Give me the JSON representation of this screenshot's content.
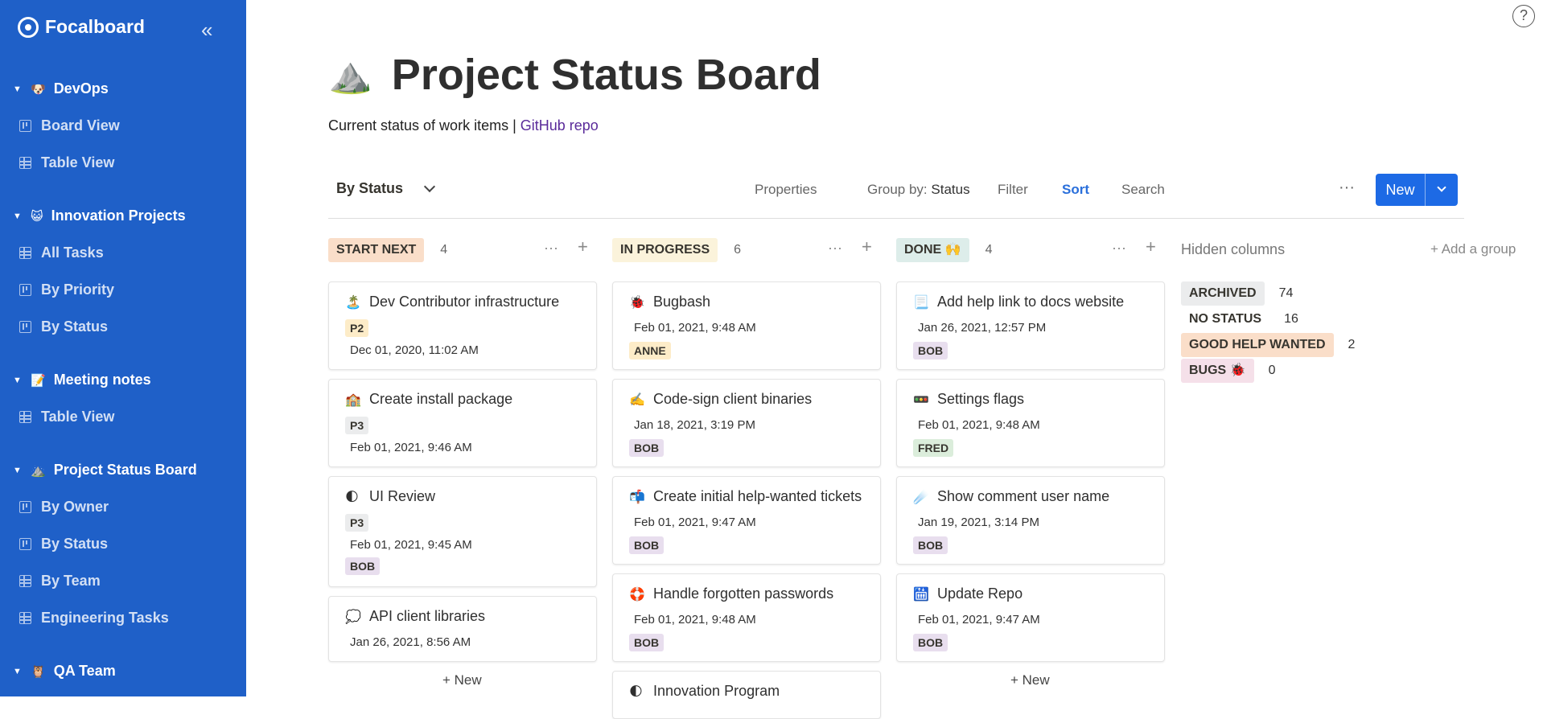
{
  "sidebar": {
    "brand": "Focalboard",
    "groups": [
      {
        "name": "DevOps",
        "icon": "🐶",
        "views": [
          {
            "label": "Board View",
            "type": "board"
          },
          {
            "label": "Table View",
            "type": "table"
          }
        ]
      },
      {
        "name": "Innovation Projects",
        "icon": "😺",
        "views": [
          {
            "label": "All Tasks",
            "type": "table"
          },
          {
            "label": "By Priority",
            "type": "board"
          },
          {
            "label": "By Status",
            "type": "board"
          }
        ]
      },
      {
        "name": "Meeting notes",
        "icon": "📝",
        "views": [
          {
            "label": "Table View",
            "type": "table"
          }
        ]
      },
      {
        "name": "Project Status Board",
        "icon": "⛰️",
        "views": [
          {
            "label": "By Owner",
            "type": "board"
          },
          {
            "label": "By Status",
            "type": "board"
          },
          {
            "label": "By Team",
            "type": "table"
          },
          {
            "label": "Engineering Tasks",
            "type": "table"
          }
        ]
      },
      {
        "name": "QA Team",
        "icon": "🦉",
        "views": []
      }
    ]
  },
  "help_label": "?",
  "board": {
    "icon": "⛰️",
    "title": "Project Status Board",
    "description": "Current status of work items | ",
    "link_text": "GitHub repo"
  },
  "viewbar": {
    "view_name": "By Status",
    "properties": "Properties",
    "group_by_label": "Group by:",
    "group_by_value": "Status",
    "filter": "Filter",
    "sort": "Sort",
    "search": "Search",
    "more": "···",
    "new": "New"
  },
  "columns": [
    {
      "label": "START NEXT",
      "color": "#fadec9",
      "count": "4",
      "cards": [
        {
          "icon": "🏝️",
          "title": "Dev Contributor infrastructure",
          "tag": "P2",
          "tag_color": "#fdecc8",
          "date": "Dec 01, 2020, 11:02 AM",
          "tag_first": true
        },
        {
          "icon": "🏫",
          "title": "Create install package",
          "tag": "P3",
          "tag_color": "#ebeced",
          "date": "Feb 01, 2021, 9:46 AM",
          "tag_first": true
        },
        {
          "icon": "🌓",
          "title": "UI Review",
          "tag": "P3",
          "tag_color": "#ebeced",
          "date": "Feb 01, 2021, 9:45 AM",
          "tag_first": true,
          "tag2": "BOB",
          "tag2_color": "#e8deee"
        },
        {
          "icon": "💭",
          "title": "API client libraries",
          "tag": "",
          "date": "Jan 26, 2021, 8:56 AM"
        }
      ],
      "add_new": "+ New"
    },
    {
      "label": "IN PROGRESS",
      "color": "#fbf3db",
      "count": "6",
      "cards": [
        {
          "icon": "🐞",
          "title": "Bugbash",
          "date": "Feb 01, 2021, 9:48 AM",
          "tag": "ANNE",
          "tag_color": "#fdecc8"
        },
        {
          "icon": "✍️",
          "title": "Code-sign client binaries",
          "date": "Jan 18, 2021, 3:19 PM",
          "tag": "BOB",
          "tag_color": "#e8deee"
        },
        {
          "icon": "📬",
          "title": "Create initial help-wanted tickets",
          "date": "Feb 01, 2021, 9:47 AM",
          "tag": "BOB",
          "tag_color": "#e8deee"
        },
        {
          "icon": "🛟",
          "title": "Handle forgotten passwords",
          "date": "Feb 01, 2021, 9:48 AM",
          "tag": "BOB",
          "tag_color": "#e8deee"
        },
        {
          "icon": "🌓",
          "title": "Innovation Program",
          "date": "",
          "tag": ""
        }
      ]
    },
    {
      "label": "DONE 🙌",
      "color": "#ddedea",
      "count": "4",
      "cards": [
        {
          "icon": "📃",
          "title": "Add help link to docs website",
          "date": "Jan 26, 2021, 12:57 PM",
          "tag": "BOB",
          "tag_color": "#e8deee"
        },
        {
          "icon": "🚥",
          "title": "Settings flags",
          "date": "Feb 01, 2021, 9:48 AM",
          "tag": "FRED",
          "tag_color": "#dbeddb"
        },
        {
          "icon": "☄️",
          "title": "Show comment user name",
          "date": "Jan 19, 2021, 3:14 PM",
          "tag": "BOB",
          "tag_color": "#e8deee"
        },
        {
          "icon": "🛗",
          "title": "Update Repo",
          "date": "Feb 01, 2021, 9:47 AM",
          "tag": "BOB",
          "tag_color": "#e8deee"
        }
      ],
      "add_new": "+ New"
    }
  ],
  "hidden": {
    "label": "Hidden columns",
    "add_group": "+ Add a group",
    "items": [
      {
        "label": "ARCHIVED",
        "count": "74",
        "color": "#ebeced"
      },
      {
        "label": "NO STATUS",
        "count": "16",
        "color": "transparent"
      },
      {
        "label": "GOOD HELP WANTED",
        "count": "2",
        "color": "#fadec9"
      },
      {
        "label": "BUGS 🐞",
        "count": "0",
        "color": "#f5e0e9"
      }
    ]
  }
}
